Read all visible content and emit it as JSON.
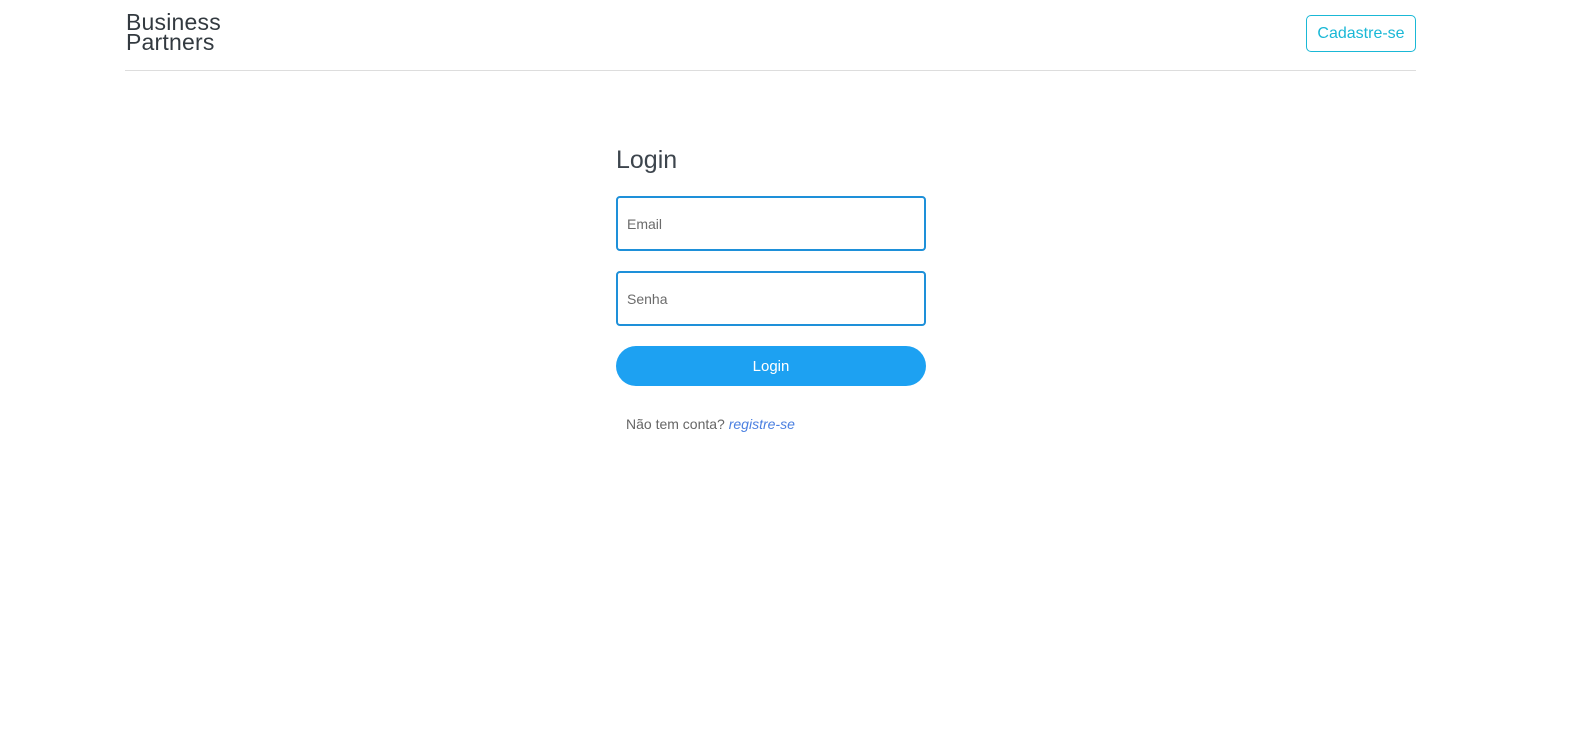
{
  "header": {
    "brand_line1": "Business",
    "brand_line2": "Partners",
    "signup_label": "Cadastre-se"
  },
  "login": {
    "title": "Login",
    "email_placeholder": "Email",
    "password_placeholder": "Senha",
    "submit_label": "Login",
    "no_account_text": "Não tem conta?",
    "register_link": "registre-se"
  },
  "colors": {
    "accent": "#1da1f2",
    "input_border": "#1e90d9",
    "signup_accent": "#1ab8d6",
    "link": "#4a7fe0"
  }
}
